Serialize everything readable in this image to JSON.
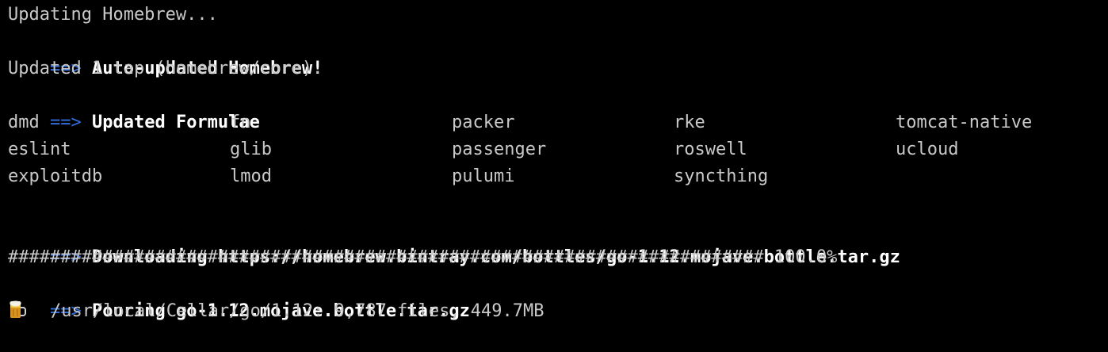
{
  "terminal": {
    "arrow": "==>",
    "colors": {
      "background": "#000000",
      "text": "#c8c8c8",
      "bold_text": "#ffffff",
      "arrow": "#2f6fe0"
    },
    "lines": {
      "updating": "Updating Homebrew...",
      "auto_updated": "Auto-updated Homebrew!",
      "updated_tap": "Updated 1 tap (homebrew/core).",
      "updated_formulae_header": "Updated Formulae",
      "downloading": "Downloading https://homebrew.bintray.com/bottles/go-1.12.mojave.bottle.tar.gz",
      "progress_bar": "######################################################################## 100.0%",
      "pouring": "Pouring go-1.12.mojave.bottle.tar.gz",
      "cellar_summary": "/usr/local/Cellar/go/1.12: 9,787 files, 449.7MB"
    },
    "progress_percent": 100.0,
    "beer_icon": "beer-mug-icon",
    "formulae": [
      [
        "dmd",
        "fn",
        "packer",
        "rke",
        "tomcat-native"
      ],
      [
        "eslint",
        "glib",
        "passenger",
        "roswell",
        "ucloud"
      ],
      [
        "exploitdb",
        "lmod",
        "pulumi",
        "syncthing",
        ""
      ]
    ]
  }
}
